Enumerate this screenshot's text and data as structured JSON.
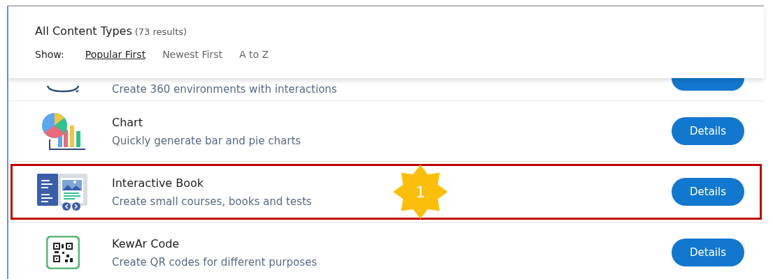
{
  "header": {
    "title": "All Content Types",
    "count": "(73 results)",
    "show_label": "Show:",
    "sort_options": [
      {
        "label": "Popular First",
        "selected": true
      },
      {
        "label": "Newest First",
        "selected": false
      },
      {
        "label": "A to Z",
        "selected": false
      }
    ]
  },
  "content_types": [
    {
      "kind": "partial",
      "description": "Create 360 environments with interactions",
      "highlighted": false
    },
    {
      "kind": "chart",
      "title": "Chart",
      "description": "Quickly generate bar and pie charts",
      "button": "Details",
      "highlighted": false
    },
    {
      "kind": "book",
      "title": "Interactive Book",
      "description": "Create small courses, books and tests",
      "button": "Details",
      "highlighted": true,
      "callout": "1"
    },
    {
      "kind": "qr",
      "title": "KewAr Code",
      "description": "Create QR codes for different purposes",
      "button": "Details",
      "highlighted": false
    }
  ]
}
